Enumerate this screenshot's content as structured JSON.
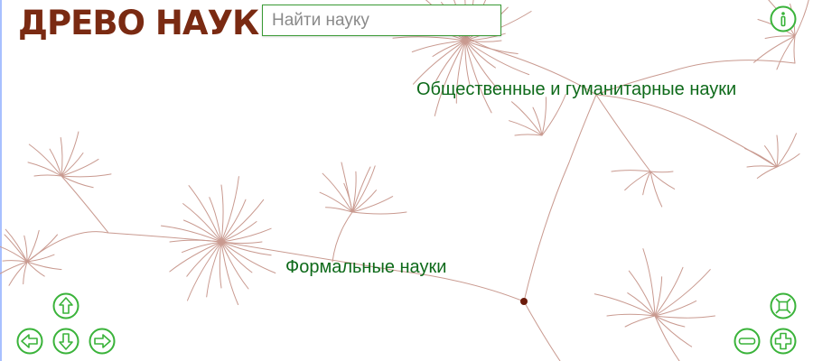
{
  "header": {
    "logo": "ДРЕВО НАУК",
    "search_placeholder": "Найти науку"
  },
  "labels": {
    "social_humanities": "Общественные и гуманитарные науки",
    "formal": "Формальные науки"
  },
  "controls": {
    "info": "info-icon",
    "pan_up": "arrow-up-icon",
    "pan_left": "arrow-left-icon",
    "pan_down": "arrow-down-icon",
    "pan_right": "arrow-right-icon",
    "fit": "fit-screen-icon",
    "zoom_out": "minus-icon",
    "zoom_in": "plus-icon"
  },
  "colors": {
    "brand": "#7a2a12",
    "accent": "#3ab33a",
    "label": "#0e6a1a",
    "branch": "#c99a90",
    "node": "#6b1a0a"
  }
}
